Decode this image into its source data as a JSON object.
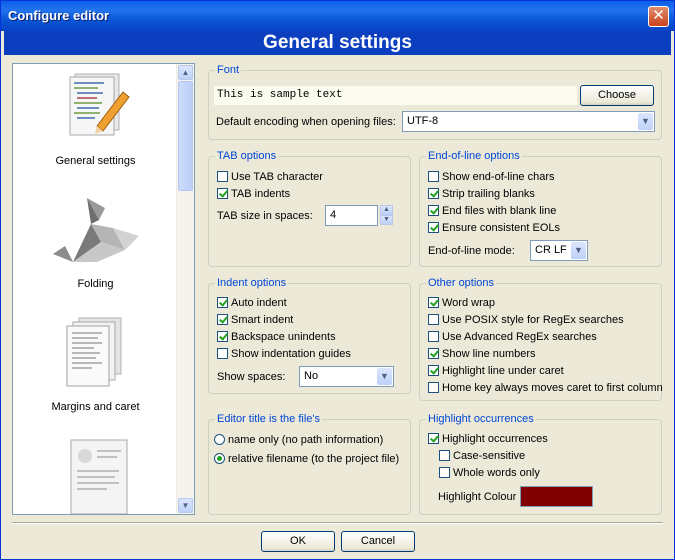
{
  "window": {
    "title": "Configure editor",
    "close_glyph": "✕"
  },
  "header": {
    "title": "General settings"
  },
  "sidebar": {
    "items": [
      {
        "label": "General settings",
        "icon": "general-settings-icon"
      },
      {
        "label": "Folding",
        "icon": "folding-icon"
      },
      {
        "label": "Margins and caret",
        "icon": "margins-caret-icon"
      },
      {
        "label": "",
        "icon": "page-preview-icon"
      }
    ]
  },
  "font_group": {
    "title": "Font",
    "sample": "This is sample text",
    "choose_label": "Choose",
    "encoding_label": "Default encoding when opening files:",
    "encoding_value": "UTF-8"
  },
  "tab_group": {
    "title": "TAB options",
    "use_tab": {
      "label": "Use TAB character",
      "checked": false
    },
    "tab_indents": {
      "label": "TAB indents",
      "checked": true
    },
    "size_label": "TAB size in spaces:",
    "size_value": "4"
  },
  "eol_group": {
    "title": "End-of-line options",
    "show_eol": {
      "label": "Show end-of-line chars",
      "checked": false
    },
    "strip_trailing": {
      "label": "Strip trailing blanks",
      "checked": true
    },
    "end_blank": {
      "label": "End files with blank line",
      "checked": true
    },
    "ensure_eol": {
      "label": "Ensure consistent EOLs",
      "checked": true
    },
    "mode_label": "End-of-line mode:",
    "mode_value": "CR LF"
  },
  "indent_group": {
    "title": "Indent options",
    "auto_indent": {
      "label": "Auto indent",
      "checked": true
    },
    "smart_indent": {
      "label": "Smart indent",
      "checked": true
    },
    "backspace": {
      "label": "Backspace unindents",
      "checked": true
    },
    "guides": {
      "label": "Show indentation guides",
      "checked": false
    },
    "spaces_label": "Show spaces:",
    "spaces_value": "No"
  },
  "other_group": {
    "title": "Other options",
    "word_wrap": {
      "label": "Word wrap",
      "checked": true
    },
    "posix": {
      "label": "Use POSIX style for RegEx searches",
      "checked": false
    },
    "advanced_regex": {
      "label": "Use Advanced RegEx searches",
      "checked": false
    },
    "line_numbers": {
      "label": "Show line numbers",
      "checked": true
    },
    "highlight_line": {
      "label": "Highlight line under caret",
      "checked": true
    },
    "home_key": {
      "label": "Home key always moves caret to first column",
      "checked": false
    }
  },
  "title_group": {
    "title": "Editor title is the file's",
    "name_only": {
      "label": "name only (no path information)",
      "checked": false
    },
    "relative": {
      "label": "relative filename (to the project file)",
      "checked": true
    }
  },
  "highlight_group": {
    "title": "Highlight occurrences",
    "highlight": {
      "label": "Highlight occurrences",
      "checked": true
    },
    "case": {
      "label": "Case-sensitive",
      "checked": false
    },
    "whole": {
      "label": "Whole words only",
      "checked": false
    },
    "colour_label": "Highlight Colour",
    "colour_value": "#800000"
  },
  "buttons": {
    "ok": "OK",
    "cancel": "Cancel"
  }
}
